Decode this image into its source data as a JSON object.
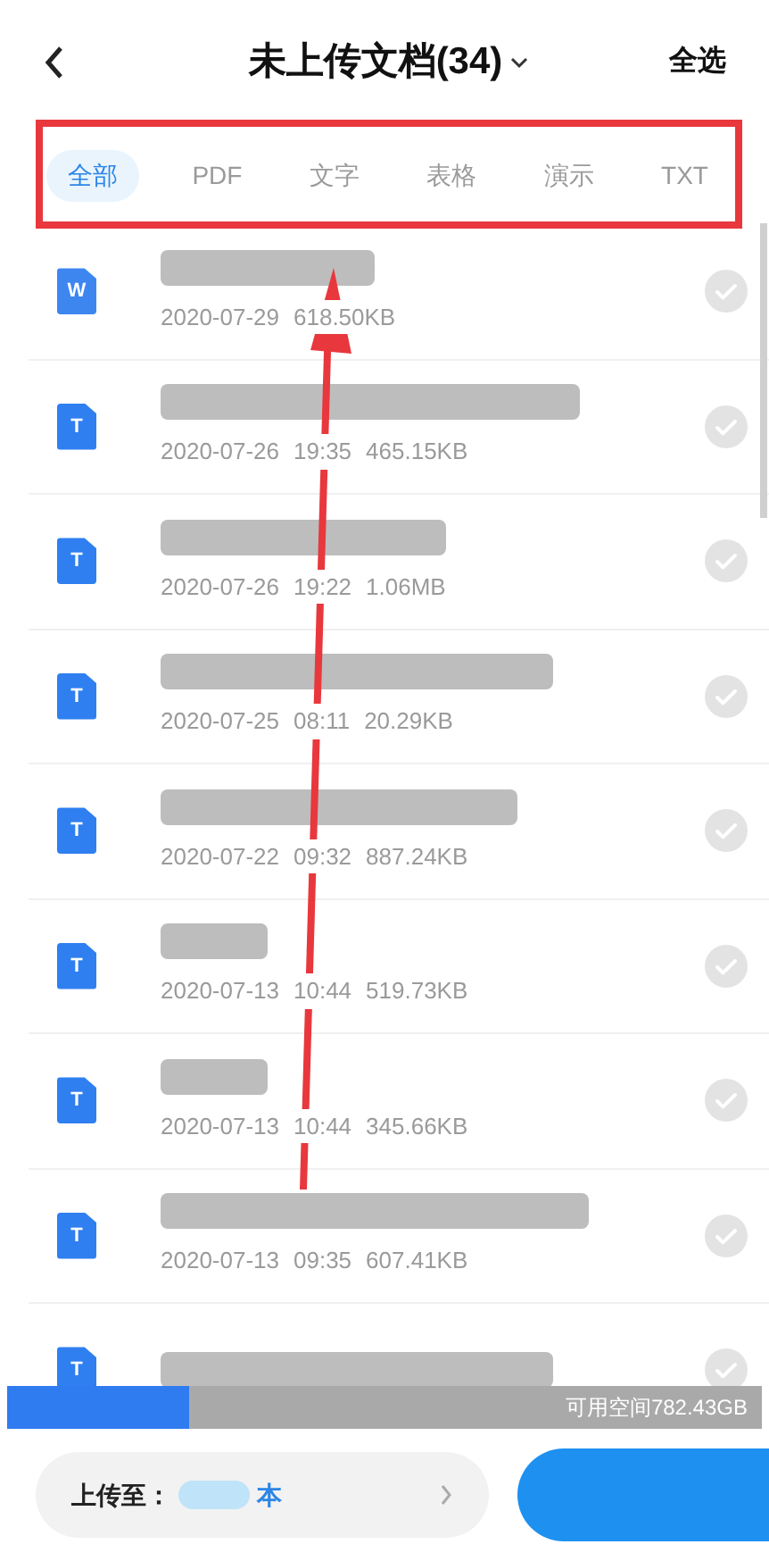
{
  "header": {
    "title": "未上传文档(34)",
    "action": "全选"
  },
  "tabs": [
    {
      "label": "全部",
      "selected": true
    },
    {
      "label": "PDF",
      "selected": false
    },
    {
      "label": "文字",
      "selected": false
    },
    {
      "label": "表格",
      "selected": false
    },
    {
      "label": "演示",
      "selected": false
    },
    {
      "label": "TXT",
      "selected": false
    }
  ],
  "files": [
    {
      "kind": "word",
      "badge": "W",
      "date": "2020-07-29",
      "size": "618.50KB",
      "checked": false
    },
    {
      "kind": "text",
      "badge": "T",
      "date": "2020-07-26",
      "time": "19:35",
      "size": "465.15KB",
      "checked": false
    },
    {
      "kind": "text",
      "badge": "T",
      "date": "2020-07-26",
      "time": "19:22",
      "size": "1.06MB",
      "checked": false
    },
    {
      "kind": "text",
      "badge": "T",
      "date": "2020-07-25",
      "time": "08:11",
      "size": "20.29KB",
      "checked": false
    },
    {
      "kind": "text",
      "badge": "T",
      "date": "2020-07-22",
      "time": "09:32",
      "size": "887.24KB",
      "checked": false
    },
    {
      "kind": "text",
      "badge": "T",
      "date": "2020-07-13",
      "time": "10:44",
      "size": "519.73KB",
      "checked": false
    },
    {
      "kind": "text",
      "badge": "T",
      "date": "2020-07-13",
      "time": "10:44",
      "size": "345.66KB",
      "checked": false
    },
    {
      "kind": "text",
      "badge": "T",
      "date": "2020-07-13",
      "time": "09:35",
      "size": "607.41KB",
      "checked": false
    },
    {
      "kind": "text",
      "badge": "T",
      "checked": false
    }
  ],
  "storage": {
    "level": 0.24,
    "label": "可用空间782.43GB"
  },
  "upload": {
    "label": "上传至：",
    "target": "本"
  }
}
